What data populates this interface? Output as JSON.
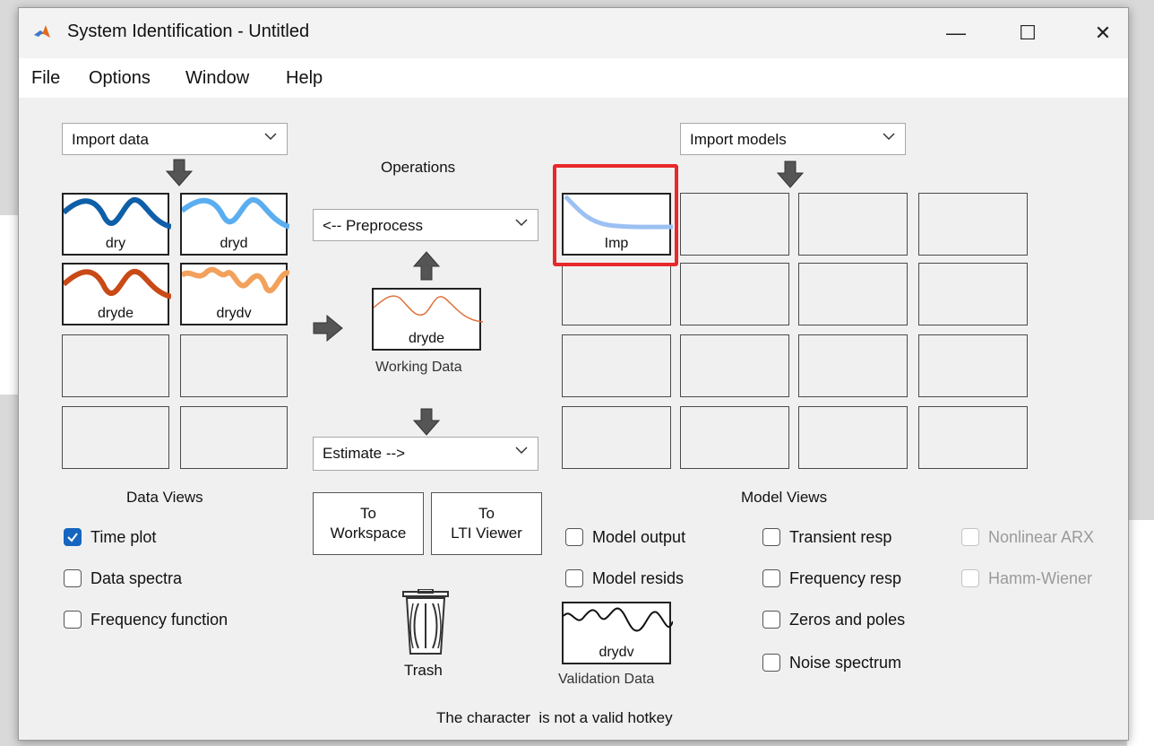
{
  "window": {
    "title": "System Identification - Untitled"
  },
  "window_controls": {
    "minimize": "—",
    "maximize": "☐",
    "close": "✕"
  },
  "menu": [
    "File",
    "Options",
    "Window",
    "Help"
  ],
  "import_data": {
    "label": "Import data"
  },
  "import_models": {
    "label": "Import models"
  },
  "operations": {
    "title": "Operations",
    "preprocess": "<-- Preprocess",
    "estimate": "Estimate -->"
  },
  "working_data": {
    "name": "dryde",
    "caption": "Working Data"
  },
  "validation_data": {
    "name": "drydv",
    "caption": "Validation Data"
  },
  "data_slots": [
    {
      "name": "dry",
      "color": "#0e5fa8"
    },
    {
      "name": "dryd",
      "color": "#5aaef0"
    },
    {
      "name": "dryde",
      "color": "#c94a17"
    },
    {
      "name": "drydv",
      "color": "#f2a15c"
    }
  ],
  "model_slots": [
    {
      "name": "Imp",
      "color": "#9cc0f2"
    }
  ],
  "buttons": {
    "to_workspace": [
      "To",
      "Workspace"
    ],
    "to_lti": [
      "To",
      "LTI Viewer"
    ]
  },
  "trash": {
    "label": "Trash"
  },
  "data_views": {
    "title": "Data Views",
    "items": [
      {
        "label": "Time plot",
        "checked": true
      },
      {
        "label": "Data spectra",
        "checked": false
      },
      {
        "label": "Frequency function",
        "checked": false
      }
    ]
  },
  "model_views": {
    "title": "Model Views",
    "col1": [
      {
        "label": "Model output"
      },
      {
        "label": "Model resids"
      }
    ],
    "col2": [
      {
        "label": "Transient resp"
      },
      {
        "label": "Frequency resp"
      },
      {
        "label": "Zeros and poles"
      },
      {
        "label": "Noise spectrum"
      }
    ],
    "col3": [
      {
        "label": "Nonlinear ARX",
        "disabled": true
      },
      {
        "label": "Hamm-Wiener",
        "disabled": true
      }
    ]
  },
  "status": {
    "text": "The character  is not a valid hotkey"
  },
  "colors": {
    "accent": "#1565c0",
    "highlight": "#e8282a",
    "working_line": "#e0703a"
  }
}
